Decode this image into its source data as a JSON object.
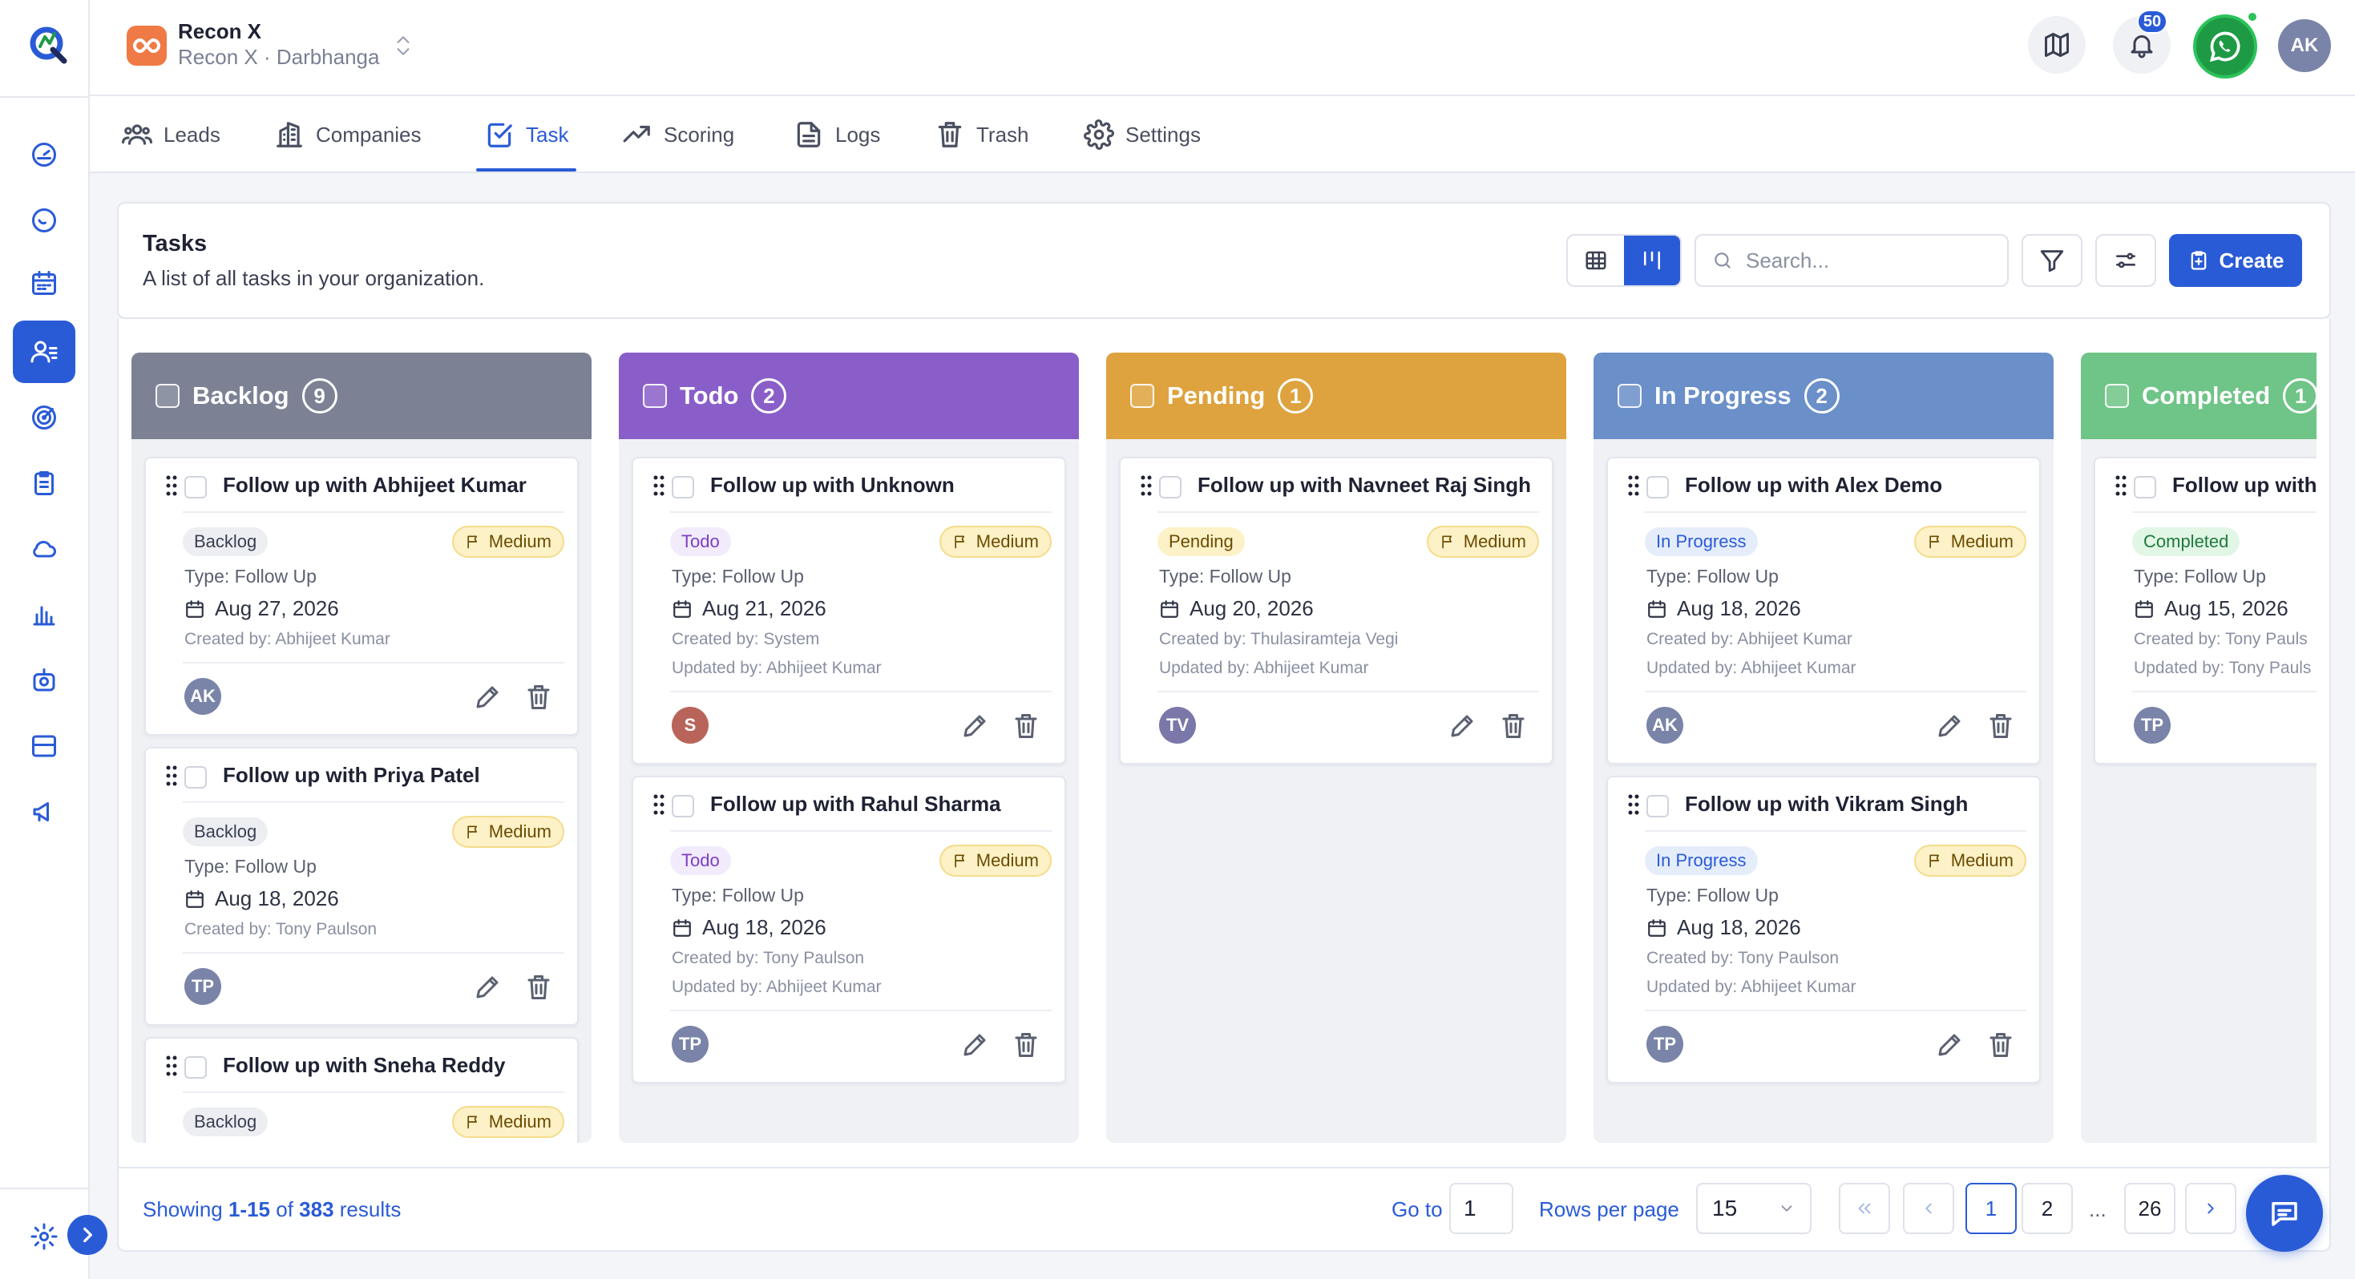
{
  "app": {
    "org_name": "Recon X",
    "org_sub": "Recon X · Darbhanga",
    "notification_count": "50",
    "user_initials": "AK"
  },
  "nav": {
    "tabs": [
      {
        "label": "Leads",
        "icon": "users-icon"
      },
      {
        "label": "Companies",
        "icon": "building-icon"
      },
      {
        "label": "Task",
        "icon": "checkbox-icon",
        "active": true
      },
      {
        "label": "Scoring",
        "icon": "trending-up-icon"
      },
      {
        "label": "Logs",
        "icon": "file-text-icon"
      },
      {
        "label": "Trash",
        "icon": "trash-icon"
      },
      {
        "label": "Settings",
        "icon": "gear-icon"
      }
    ]
  },
  "header": {
    "title": "Tasks",
    "subtitle": "A list of all tasks in your organization.",
    "search_placeholder": "Search...",
    "create_label": "Create"
  },
  "columns": [
    {
      "title": "Backlog",
      "count": "9",
      "color": "#7c8294"
    },
    {
      "title": "Todo",
      "count": "2",
      "color": "#8a5ec8"
    },
    {
      "title": "Pending",
      "count": "1",
      "color": "#dea33e"
    },
    {
      "title": "In Progress",
      "count": "2",
      "color": "#6a8fc9"
    },
    {
      "title": "Completed",
      "count": "1",
      "color": "#6fc487"
    }
  ],
  "cards": {
    "backlog": [
      {
        "title": "Follow up with Abhijeet Kumar",
        "status": "Backlog",
        "priority": "Medium",
        "type": "Type: Follow Up",
        "date": "Aug 27, 2026",
        "created_by": "Created by: Abhijeet Kumar",
        "avatar": "AK"
      },
      {
        "title": "Follow up with Priya Patel",
        "status": "Backlog",
        "priority": "Medium",
        "type": "Type: Follow Up",
        "date": "Aug 18, 2026",
        "created_by": "Created by: Tony Paulson",
        "avatar": "TP"
      },
      {
        "title": "Follow up with Sneha Reddy",
        "status": "Backlog",
        "priority": "Medium"
      }
    ],
    "todo": [
      {
        "title": "Follow up with Unknown",
        "status": "Todo",
        "priority": "Medium",
        "type": "Type: Follow Up",
        "date": "Aug 21, 2026",
        "created_by": "Created by: System",
        "updated_by": "Updated by: Abhijeet Kumar",
        "avatar": "S"
      },
      {
        "title": "Follow up with Rahul Sharma",
        "status": "Todo",
        "priority": "Medium",
        "type": "Type: Follow Up",
        "date": "Aug 18, 2026",
        "created_by": "Created by: Tony Paulson",
        "updated_by": "Updated by: Abhijeet Kumar",
        "avatar": "TP"
      }
    ],
    "pending": [
      {
        "title": "Follow up with Navneet Raj Singh",
        "status": "Pending",
        "priority": "Medium",
        "type": "Type: Follow Up",
        "date": "Aug 20, 2026",
        "created_by": "Created by: Thulasiramteja Vegi",
        "updated_by": "Updated by: Abhijeet Kumar",
        "avatar": "TV"
      }
    ],
    "progress": [
      {
        "title": "Follow up with Alex Demo",
        "status": "In Progress",
        "priority": "Medium",
        "type": "Type: Follow Up",
        "date": "Aug 18, 2026",
        "created_by": "Created by: Abhijeet Kumar",
        "updated_by": "Updated by: Abhijeet Kumar",
        "avatar": "AK"
      },
      {
        "title": "Follow up with Vikram Singh",
        "status": "In Progress",
        "priority": "Medium",
        "type": "Type: Follow Up",
        "date": "Aug 18, 2026",
        "created_by": "Created by: Tony Paulson",
        "updated_by": "Updated by: Abhijeet Kumar",
        "avatar": "TP"
      }
    ],
    "completed": [
      {
        "title": "Follow up with A",
        "status": "Completed",
        "type": "Type: Follow Up",
        "date": "Aug 15, 2026",
        "created_by": "Created by: Tony Pauls",
        "updated_by": "Updated by: Tony Pauls",
        "avatar": "TP"
      }
    ]
  },
  "footer": {
    "showing_prefix": "Showing ",
    "showing_range": "1-15",
    "showing_of": " of ",
    "showing_total": "383",
    "showing_suffix": " results",
    "goto_label": "Go to",
    "goto_value": "1",
    "rows_label": "Rows per page",
    "rows_value": "15",
    "pages": [
      "1",
      "2",
      "...",
      "26"
    ],
    "current_page": "1"
  },
  "colors": {
    "accent": "#2a5bd7",
    "avatar_ak": "#7a84a8",
    "avatar_s": "#b8645a",
    "avatar_tp": "#7a84a8",
    "avatar_tv": "#7a78a8"
  }
}
